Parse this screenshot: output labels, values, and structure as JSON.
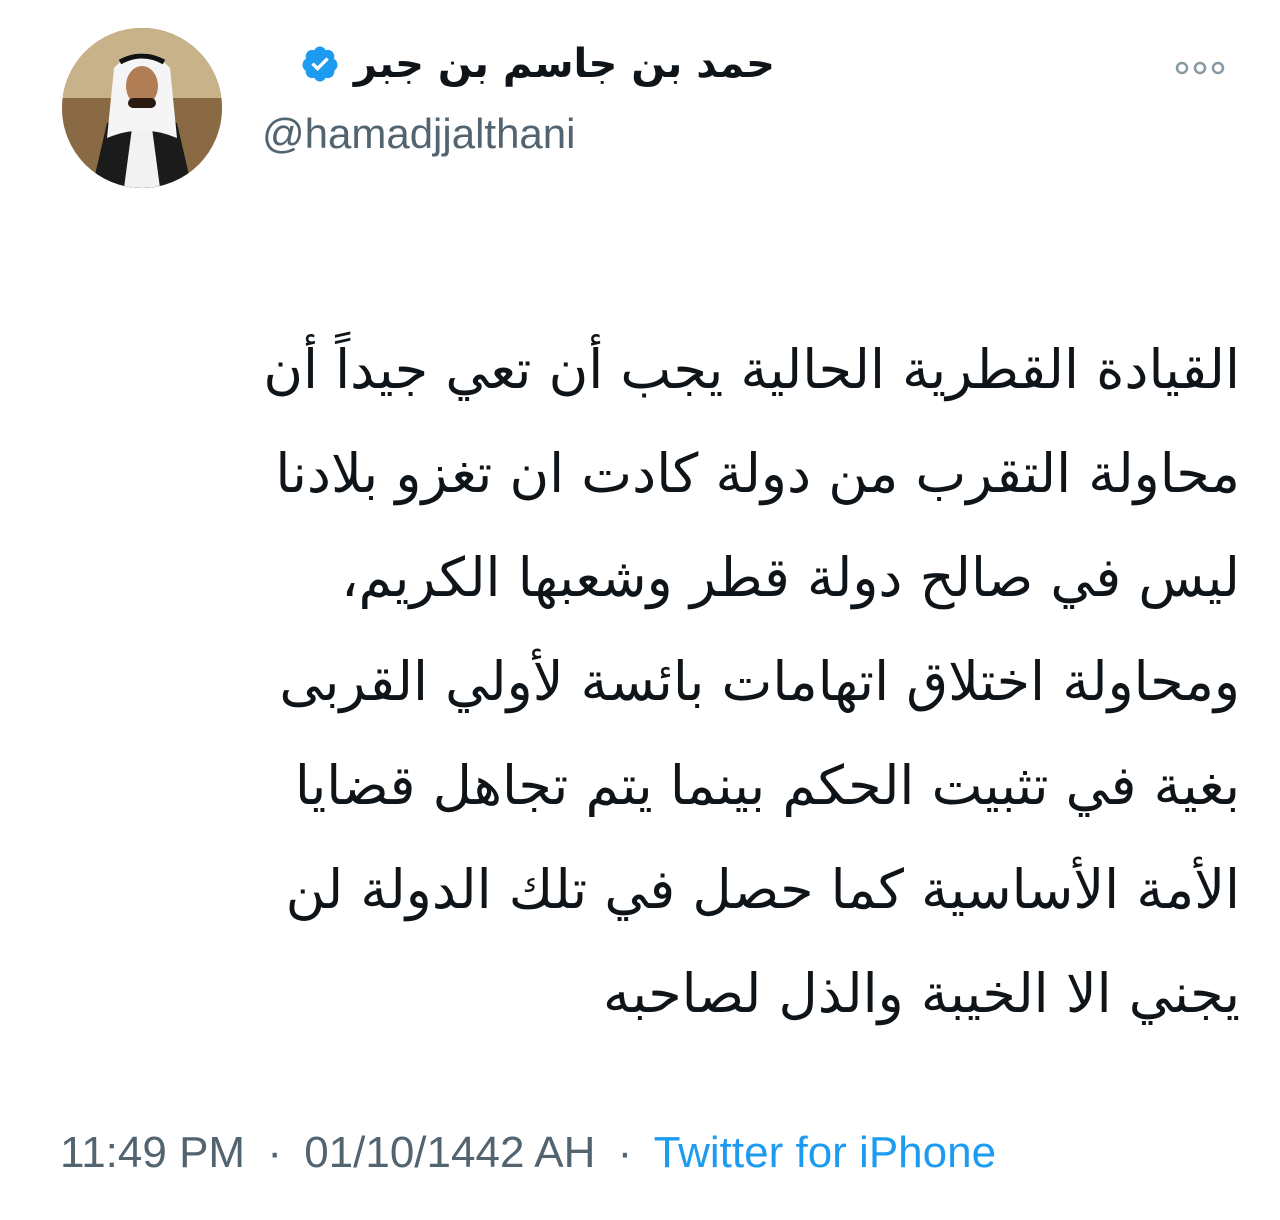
{
  "author": {
    "display_name": "حمد بن جاسم بن جبر",
    "handle": "@hamadjjalthani",
    "verified": true,
    "avatar_icon": "profile-photo"
  },
  "more_icon": "ellipsis-horizontal-icon",
  "tweet": {
    "lines": [
      "القيادة القطرية الحالية يجب أن تعي جيداً أن",
      "محاولة التقرب من دولة كادت ان تغزو بلادنا",
      "ليس في صالح دولة قطر وشعبها الكريم،",
      "ومحاولة اختلاق اتهامات بائسة لأولي القربى",
      "بغية في تثبيت الحكم بينما يتم تجاهل قضايا",
      "الأمة الأساسية كما حصل في تلك الدولة لن",
      "يجني الا الخيبة والذل لصاحبه"
    ]
  },
  "meta": {
    "time": "11:49 PM",
    "separator": "·",
    "date": "01/10/1442 AH",
    "source": "Twitter for iPhone"
  },
  "colors": {
    "verified_badge": "#1d9bf0",
    "secondary_text": "#536471",
    "link": "#1d9bf0",
    "primary_text": "#0f1419"
  }
}
